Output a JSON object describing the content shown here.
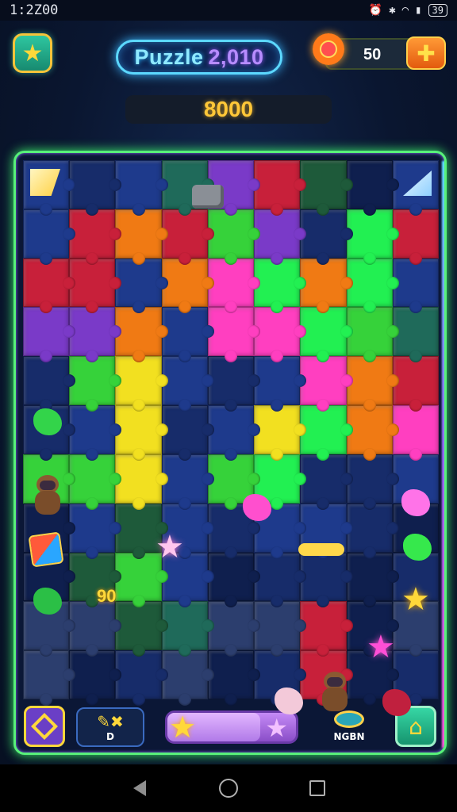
{
  "status_bar": {
    "time": "1:2Z00",
    "battery": "39",
    "icons": [
      "alarm-icon",
      "bluetooth-icon",
      "wifi-icon",
      "signal-icon",
      "battery-icon"
    ]
  },
  "header": {
    "title_word": "Puzzle",
    "title_number": "2,010",
    "coins": "50",
    "score": "8000"
  },
  "board": {
    "colors": {
      "B": "#1e3a8c",
      "N": "#172c6a",
      "D": "#0f1f4e",
      "R": "#c8203a",
      "O": "#f07a14",
      "Y": "#f2e020",
      "G": "#36d23a",
      "L": "#22f052",
      "P": "#ff3fc0",
      "U": "#7a3ac8",
      "C": "#2ee0d8",
      "T": "#1f6a5a",
      "E": "#1e5a3a",
      "S": "#2c3e6e"
    },
    "rows": [
      "BNBTUREDB",
      "BRORGUNLR",
      "RRBOPLOLB",
      "UUOBPPLGT",
      "NGYBNBPOR",
      "NBYNBYLOP",
      "GGYBGLNNB",
      "DBEBNBBND",
      "DEGBDNNDN",
      "SSETSSRDS",
      "SDNSDNRDN"
    ],
    "floating_number": "90"
  },
  "toolbar": {
    "tools_label": "D",
    "bonus_label": "NGBN",
    "progress_fraction": 0.72
  }
}
